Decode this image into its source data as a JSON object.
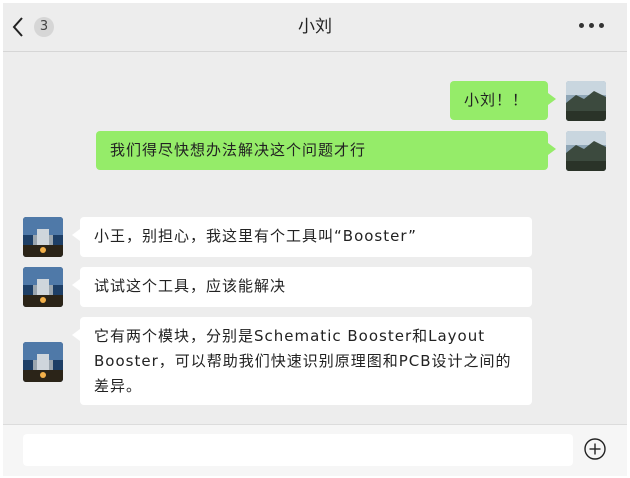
{
  "header": {
    "title": "小刘",
    "unread_count": "3"
  },
  "messages": [
    {
      "sender": "self",
      "text": "小刘！！"
    },
    {
      "sender": "self",
      "text": "我们得尽快想办法解决这个问题才行"
    },
    {
      "sender": "other",
      "text": "小王，别担心，我这里有个工具叫“Booster”"
    },
    {
      "sender": "other",
      "text": "试试这个工具，应该能解决"
    },
    {
      "sender": "other",
      "text": "它有两个模块，分别是Schematic Booster和Layout Booster，可以帮助我们快速识别原理图和PCB设计之间的差异。"
    }
  ],
  "input": {
    "value": "",
    "placeholder": ""
  },
  "icons": {
    "back": "chevron-left-icon",
    "more": "more-dots-icon",
    "add": "plus-circle-icon"
  },
  "colors": {
    "self_bubble": "#95ec69",
    "other_bubble": "#ffffff",
    "background": "#ededed"
  }
}
